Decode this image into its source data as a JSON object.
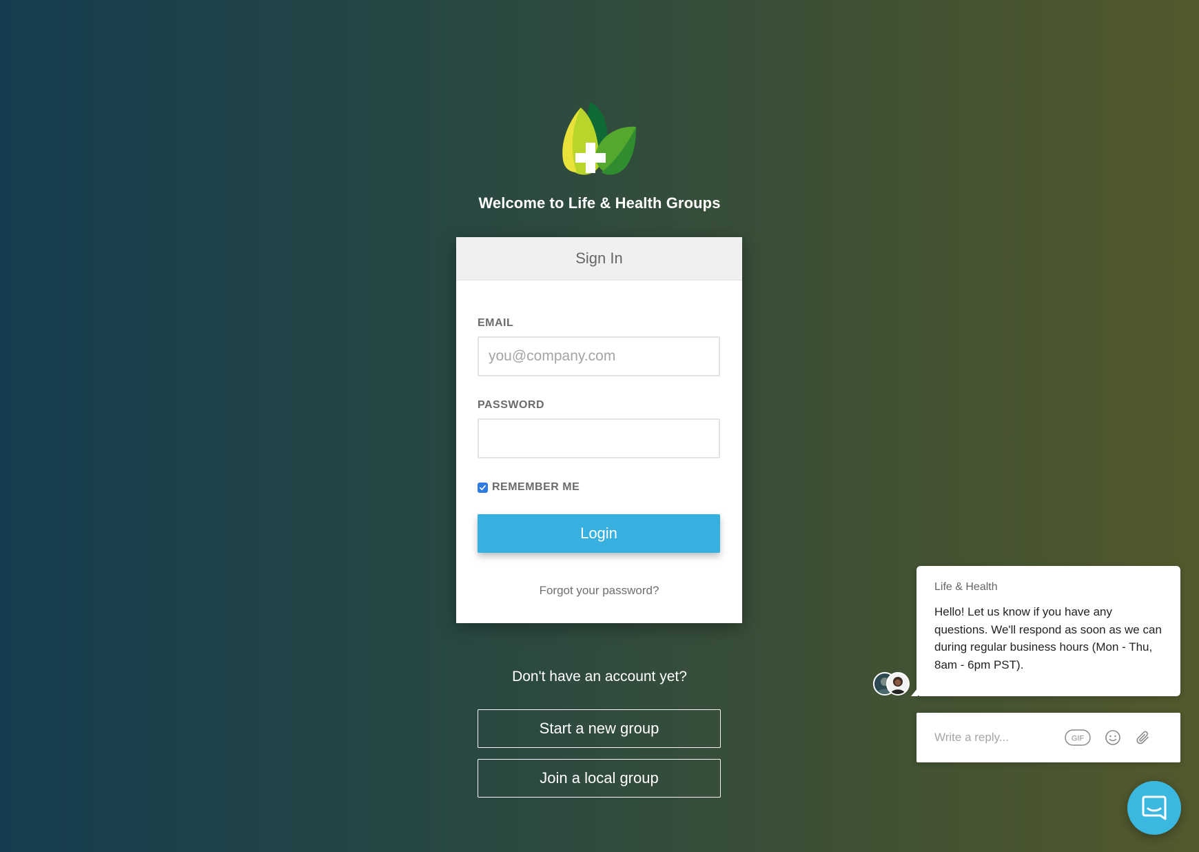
{
  "header": {
    "logo_icon": "leaf-cross-logo",
    "welcome": "Welcome to Life & Health Groups"
  },
  "signin": {
    "title": "Sign In",
    "email_label": "EMAIL",
    "email_placeholder": "you@company.com",
    "email_value": "",
    "password_label": "PASSWORD",
    "password_value": "",
    "remember_label": "REMEMBER ME",
    "remember_checked": true,
    "login_label": "Login",
    "forgot_label": "Forgot your password?"
  },
  "signup": {
    "prompt": "Don't have an account yet?",
    "start_label": "Start a new group",
    "join_label": "Join a local group"
  },
  "chat": {
    "sender": "Life & Health",
    "message": "Hello! Let us know if you have any questions. We'll respond as soon as we can during regular business hours (Mon - Thu, 8am - 6pm PST).",
    "reply_placeholder": "Write a reply...",
    "gif_label": "GIF",
    "emoji_icon": "smiley-icon",
    "attach_icon": "paperclip-icon",
    "launcher_icon": "chat-launcher-icon"
  },
  "colors": {
    "login_button": "#37b0e0",
    "checkbox": "#2f7de1",
    "launcher": "#3bb8e0",
    "background_left": "#153d4f",
    "background_right": "#53592c"
  }
}
